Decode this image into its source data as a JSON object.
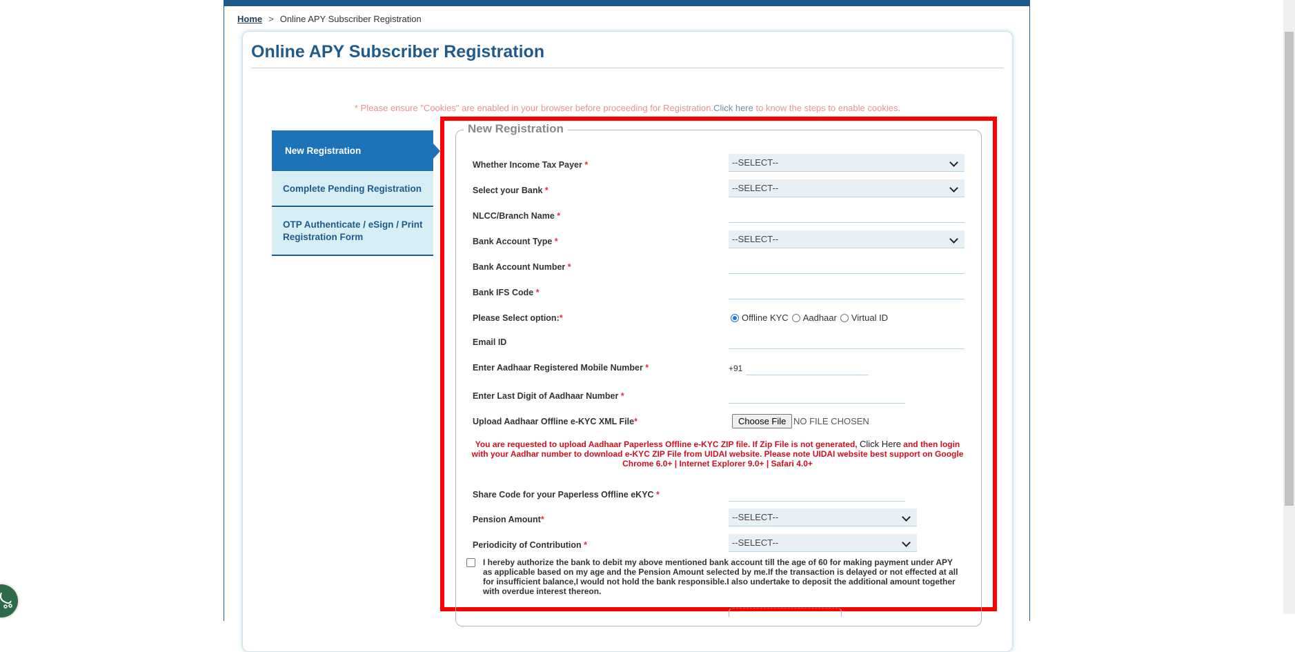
{
  "breadcrumb": {
    "home": "Home",
    "separator": ">",
    "current": "Online APY Subscriber Registration"
  },
  "page_title": "Online APY Subscriber Registration",
  "cookie_note": {
    "text": "* Please ensure \"Cookies\" are enabled in your browser before proceeding for Registration.",
    "link_click": "Click",
    "link_here": " here",
    "suffix": " to know the steps to enable cookies."
  },
  "tabs": [
    {
      "label": "New Registration",
      "active": true
    },
    {
      "label": "Complete Pending Registration",
      "active": false
    },
    {
      "label": "OTP Authenticate / eSign / Print Registration Form",
      "active": false
    }
  ],
  "form": {
    "legend": "New Registration",
    "required_mark": "*",
    "fields": {
      "income_tax": {
        "label": "Whether Income Tax Payer ",
        "value": "--SELECT--"
      },
      "bank": {
        "label": "Select your Bank ",
        "value": "--SELECT--"
      },
      "branch": {
        "label": "NLCC/Branch Name ",
        "value": ""
      },
      "account_type": {
        "label": "Bank Account Type ",
        "value": "--SELECT--"
      },
      "account_number": {
        "label": "Bank Account Number ",
        "value": ""
      },
      "ifsc": {
        "label": "Bank IFS Code ",
        "value": ""
      },
      "option": {
        "label": "Please Select option:",
        "choices": [
          "Offline KYC",
          "Aadhaar",
          "Virtual ID"
        ],
        "selected": "Offline KYC"
      },
      "email": {
        "label": "Email ID",
        "value": ""
      },
      "mobile": {
        "label": "Enter Aadhaar Registered Mobile Number ",
        "prefix": "+91",
        "value": ""
      },
      "last_digit": {
        "label": "Enter Last Digit of Aadhaar Number ",
        "value": ""
      },
      "upload": {
        "label": "Upload Aadhaar Offline e-KYC XML File",
        "button": "Choose File",
        "status": "NO FILE CHOSEN"
      },
      "share_code": {
        "label": "Share Code for your Paperless Offline eKYC ",
        "value": ""
      },
      "pension_amount": {
        "label": "Pension Amount",
        "value": "--SELECT--"
      },
      "periodicity": {
        "label": "Periodicity of Contribution ",
        "value": "--SELECT--"
      }
    },
    "upload_note": {
      "part1": "You are requested to upload Aadhaar Paperless Offline e-KYC ZIP file. If Zip File is not generated, ",
      "link": "Click Here",
      "part2": " and then login with your Aadhar number to download e-KYC ZIP File from UIDAI website. Please note UIDAI website best support on Google Chrome 6.0+ | Internet Explorer 9.0+ | Safari 4.0+"
    },
    "consent": {
      "checked": false,
      "text": "I hereby authorize the bank to debit my above mentioned bank account till the age of 60 for making payment under APY as applicable based on my age and the Pension Amount selected by me.If the transaction is delayed or not effected at all for insufficient balance,I would not hold the bank responsible.I also undertake to deposit the additional amount together with overdue interest thereon."
    }
  },
  "colors": {
    "brand_blue": "#1f5a8c",
    "active_tab": "#1e72b8",
    "highlight_box": "#ff0000",
    "required": "#e0303a"
  }
}
